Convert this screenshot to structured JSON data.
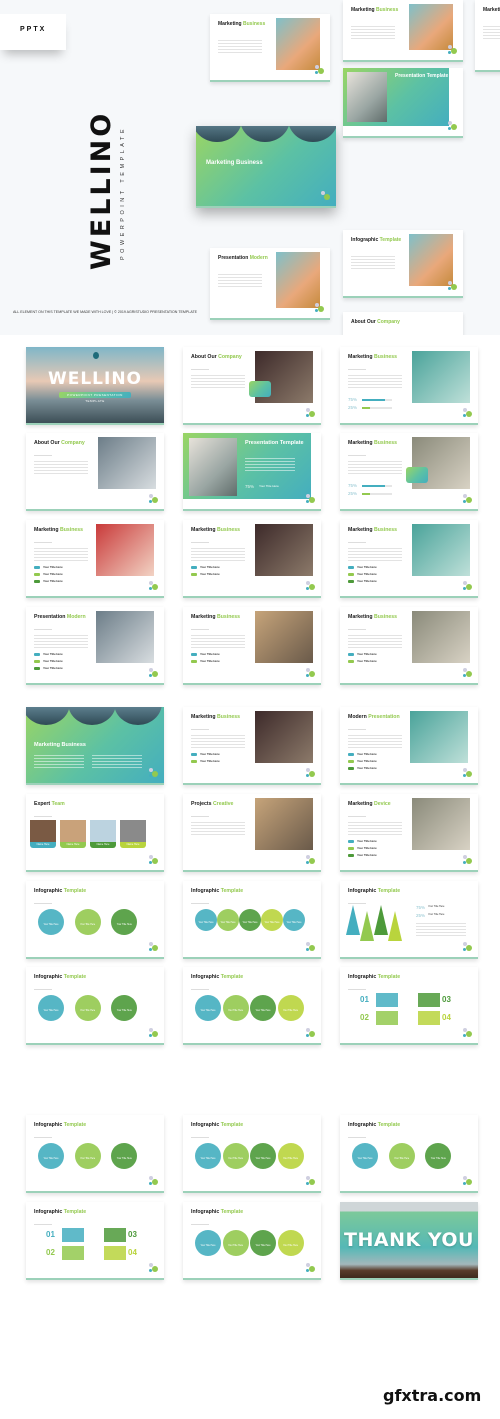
{
  "hero": {
    "format_label": "PPTX",
    "brand_title": "WELLINO",
    "brand_subtitle": "POWERPOINT TEMPLATE",
    "footnote": "ALL ELEMENT ON THIS TEMPLATE WE MADE WITH LOVE | © 2019 AGRISTUDIO PRESENTATION TEMPLATE",
    "collage": [
      {
        "title": "Marketing",
        "accent": "Business"
      },
      {
        "title": "Marketing",
        "accent": "Business"
      },
      {
        "title": "Marketing Business",
        "accent": ""
      },
      {
        "title": "Presentation",
        "accent": "Template"
      },
      {
        "title": "Presentation",
        "accent": "Modern"
      },
      {
        "title": "Infographic",
        "accent": "Template"
      },
      {
        "title": "About Our",
        "accent": "Company"
      },
      {
        "title": "Marketing",
        "accent": ""
      }
    ]
  },
  "slides": [
    {
      "kind": "cover",
      "title": "WELLINO",
      "accent": "",
      "tagline": "POWERPOINT PRESENTATION TEMPLATE"
    },
    {
      "kind": "content",
      "title": "About Our",
      "accent": "Company",
      "card": "Your Title Here"
    },
    {
      "kind": "stats",
      "title": "Marketing",
      "accent": "Business",
      "stats": [
        {
          "value": "75%",
          "label": "Your Title Here",
          "fill": 0.75
        },
        {
          "value": "25%",
          "label": "Your Title Here",
          "fill": 0.25
        }
      ]
    },
    {
      "kind": "content",
      "title": "About Our",
      "accent": "Company"
    },
    {
      "kind": "gradient",
      "title": "Presentation",
      "accent": "Template",
      "stat": "75%",
      "stat_label": "Your Title Here"
    },
    {
      "kind": "stats",
      "title": "Marketing",
      "accent": "Business",
      "card": "Your Title Here",
      "stats": [
        {
          "value": "75%",
          "label": "Your Title Here",
          "fill": 0.75
        },
        {
          "value": "25%",
          "label": "Your Title Here",
          "fill": 0.25
        }
      ]
    },
    {
      "kind": "list",
      "title": "Marketing",
      "accent": "Business",
      "items": [
        "Your Title Here",
        "Your Title Here",
        "Your Title Here"
      ]
    },
    {
      "kind": "list",
      "title": "Marketing",
      "accent": "Business",
      "items": [
        "Your Title Here",
        "Your Title Here"
      ]
    },
    {
      "kind": "list",
      "title": "Marketing",
      "accent": "Business",
      "items": [
        "Your Title Here",
        "Your Title Here",
        "Your Title Here"
      ]
    },
    {
      "kind": "list",
      "title": "Presentation",
      "accent": "Modern",
      "items": [
        "Your Title Here",
        "Your Title Here",
        "Your Title Here"
      ]
    },
    {
      "kind": "list",
      "title": "Marketing",
      "accent": "Business",
      "items": [
        "Your Title Here",
        "Your Title Here"
      ]
    },
    {
      "kind": "list",
      "title": "Marketing",
      "accent": "Business",
      "items": [
        "Your Title Here",
        "Your Title Here"
      ]
    },
    {
      "kind": "gradient-wave",
      "title": "Marketing Business",
      "accent": ""
    },
    {
      "kind": "list",
      "title": "Marketing",
      "accent": "Business",
      "items": [
        "Your Title Here",
        "Your Title Here"
      ]
    },
    {
      "kind": "list",
      "title": "Modern",
      "accent": "Presentation",
      "items": [
        "Your Title Here",
        "Your Title Here",
        "Your Title Here"
      ]
    },
    {
      "kind": "team",
      "title": "Expert",
      "accent": "Team",
      "members": [
        "Name Here",
        "Name Here",
        "Name Here",
        "Name Here"
      ]
    },
    {
      "kind": "content",
      "title": "Projects",
      "accent": "Creative"
    },
    {
      "kind": "device",
      "title": "Marketing",
      "accent": "Device",
      "items": [
        "Your Title Here",
        "Your Title Here",
        "Your Title Here"
      ]
    },
    {
      "kind": "infographic",
      "title": "Infographic",
      "accent": "Template",
      "items": [
        "Your Title Here",
        "Your Title Here",
        "Your Title Here"
      ]
    },
    {
      "kind": "infographic",
      "title": "Infographic",
      "accent": "Template",
      "items": [
        "Your Title Here",
        "Your Title Here",
        "Your Title Here",
        "Your Title Here",
        "Your Title Here"
      ]
    },
    {
      "kind": "infographic",
      "title": "Infographic",
      "accent": "Template",
      "stats": [
        {
          "value": "75%",
          "label": "Your Title Here"
        },
        {
          "value": "25%",
          "label": "Your Title Here"
        }
      ]
    },
    {
      "kind": "infographic",
      "title": "Infographic",
      "accent": "Template",
      "items": [
        "Your Title Here",
        "Your Title Here",
        "Your Title Here"
      ]
    },
    {
      "kind": "infographic",
      "title": "Infographic",
      "accent": "Template",
      "items": [
        "Your Title Here",
        "Your Title Here",
        "Your Title Here",
        "Your Title Here"
      ]
    },
    {
      "kind": "infographic",
      "title": "Infographic",
      "accent": "Template",
      "numbers": [
        "01",
        "02",
        "03",
        "04"
      ]
    },
    {
      "kind": "infographic",
      "title": "Infographic",
      "accent": "Template",
      "items": [
        "Your Title Here",
        "Your Title Here",
        "Your Title Here"
      ]
    },
    {
      "kind": "infographic",
      "title": "Infographic",
      "accent": "Template",
      "items": [
        "Your Title Here",
        "Your Title Here",
        "Your Title Here",
        "Your Title Here"
      ]
    },
    {
      "kind": "infographic",
      "title": "Infographic",
      "accent": "Template",
      "items": [
        "Your Title Here",
        "Your Title Here",
        "Your Title Here"
      ]
    },
    {
      "kind": "infographic",
      "title": "Infographic",
      "accent": "Template",
      "numbers": [
        "01",
        "02",
        "03",
        "04"
      ]
    },
    {
      "kind": "infographic",
      "title": "Infographic",
      "accent": "Template",
      "items": [
        "Your Title Here",
        "Your Title Here",
        "Your Title Here",
        "Your Title Here"
      ]
    },
    {
      "kind": "thankyou",
      "title": "THANK YOU",
      "accent": ""
    }
  ],
  "colors": {
    "teal": "#44aebf",
    "green": "#93c94f",
    "dark_green": "#4d9a3a",
    "lime": "#b9d43d"
  },
  "watermark": "gfxtra.com"
}
